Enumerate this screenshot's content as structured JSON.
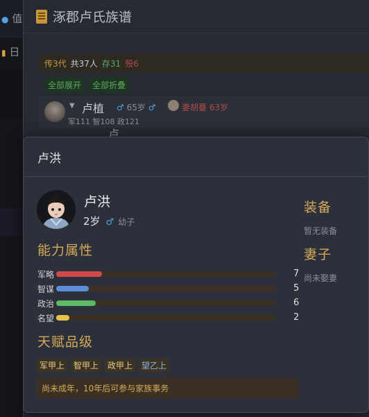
{
  "background": {
    "left_fragments": [
      "值",
      "日"
    ],
    "panel_title": "涿郡卢氏族谱",
    "stats": {
      "generations": "传3代",
      "total": "共37人",
      "alive": "存31",
      "dead": "殁6"
    },
    "buttons": {
      "expand_all": "全部展开",
      "collapse_all": "全部折叠"
    },
    "member": {
      "name": "卢植",
      "age": "65岁",
      "spouse": "妻胡蔓 63岁",
      "stats": "军111 智108 政121"
    },
    "member2": {
      "name": "卢"
    }
  },
  "modal": {
    "title": "卢洪",
    "name": "卢洪",
    "age": "2岁",
    "role": "幼子",
    "abilities_title": "能力属性",
    "abilities": [
      {
        "label": "军略",
        "value": "7",
        "ratio": 0.07,
        "color": "#d04a4a"
      },
      {
        "label": "智谋",
        "value": "5",
        "ratio": 0.05,
        "color": "#5a8fd6"
      },
      {
        "label": "政治",
        "value": "6",
        "ratio": 0.06,
        "color": "#5dbb63"
      },
      {
        "label": "名望",
        "value": "2",
        "ratio": 0.02,
        "color": "#e6c24a"
      }
    ],
    "talent_title": "天赋品级",
    "talents": [
      "军甲上",
      "智甲上",
      "政甲上",
      "望乙上"
    ],
    "note": "尚未成年，10年后可参与家族事务",
    "equipment_title": "装备",
    "equipment_text": "暂无装备",
    "spouse_title": "妻子",
    "spouse_text": "尚未娶妻"
  },
  "colors": {
    "accent_gold": "#d6a95a",
    "male_icon": "#5aa0e0"
  }
}
